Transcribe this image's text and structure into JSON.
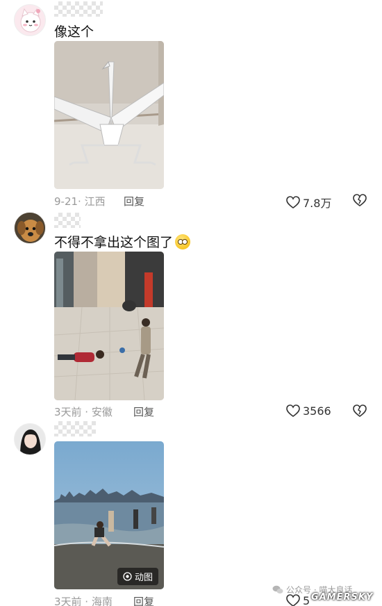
{
  "comments": [
    {
      "text": "像这个",
      "time_location": "9-21· 江西",
      "reply_label": "回复",
      "likes": "7.8万"
    },
    {
      "text": "不得不拿出这个图了",
      "time_location": "3天前 · 安徽",
      "reply_label": "回复",
      "likes": "3566"
    },
    {
      "text": "",
      "time_location": "3天前 · 海南",
      "reply_label": "回复",
      "likes": "5",
      "media_badge": "动图"
    }
  ],
  "watermark": {
    "text": "公众号 · 喵大良话",
    "logo": "GAMERSKY"
  },
  "icons": {
    "like": "heart-outline-icon",
    "dislike": "broken-heart-icon",
    "gif": "gif-play-icon",
    "wechat": "wechat-icon"
  }
}
